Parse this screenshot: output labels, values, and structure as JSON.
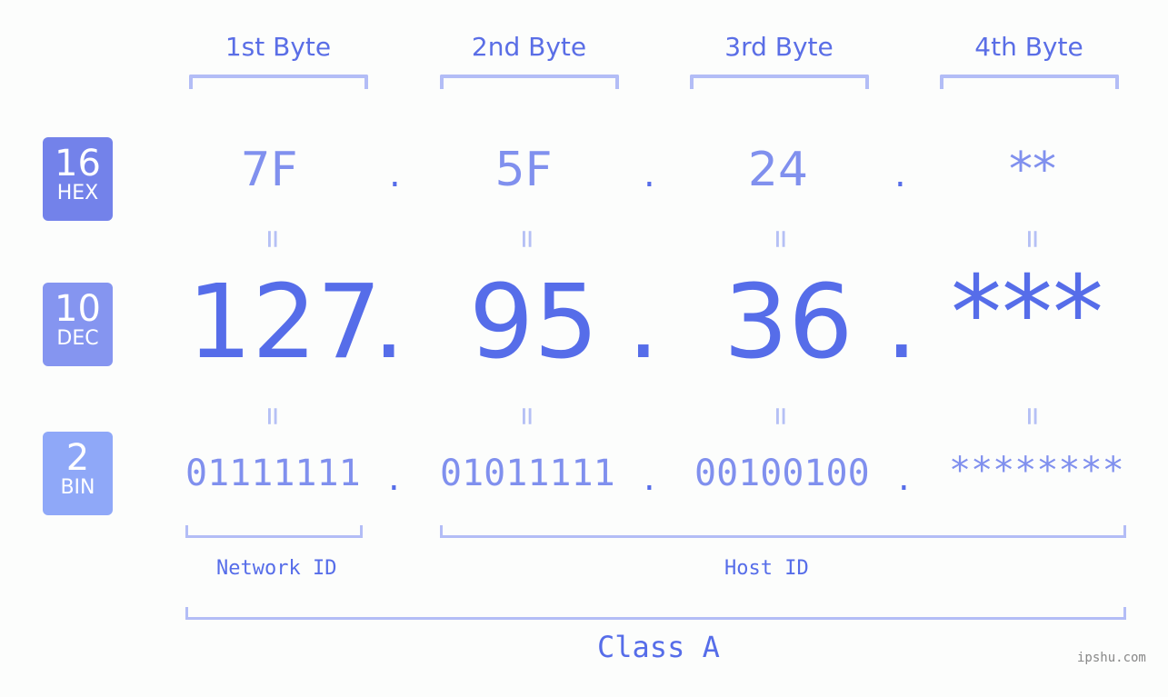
{
  "bytes": {
    "headers": [
      "1st Byte",
      "2nd Byte",
      "3rd Byte",
      "4th Byte"
    ]
  },
  "bases": {
    "hex": {
      "num": "16",
      "label": "HEX",
      "color": "#7382ea"
    },
    "dec": {
      "num": "10",
      "label": "DEC",
      "color": "#8595f0"
    },
    "bin": {
      "num": "2",
      "label": "BIN",
      "color": "#8fa8f8"
    }
  },
  "values": {
    "hex": [
      "7F",
      "5F",
      "24",
      "**"
    ],
    "dec": [
      "127",
      "95",
      "36",
      "***"
    ],
    "bin": [
      "01111111",
      "01011111",
      "00100100",
      "********"
    ]
  },
  "separator": ".",
  "equals": "=",
  "labels": {
    "network_id": "Network ID",
    "host_id": "Host ID",
    "class": "Class A"
  },
  "watermark": "ipshu.com",
  "colors": {
    "accent": "#566de9",
    "light": "#8090ee",
    "bracket": "#b3bdf6"
  }
}
